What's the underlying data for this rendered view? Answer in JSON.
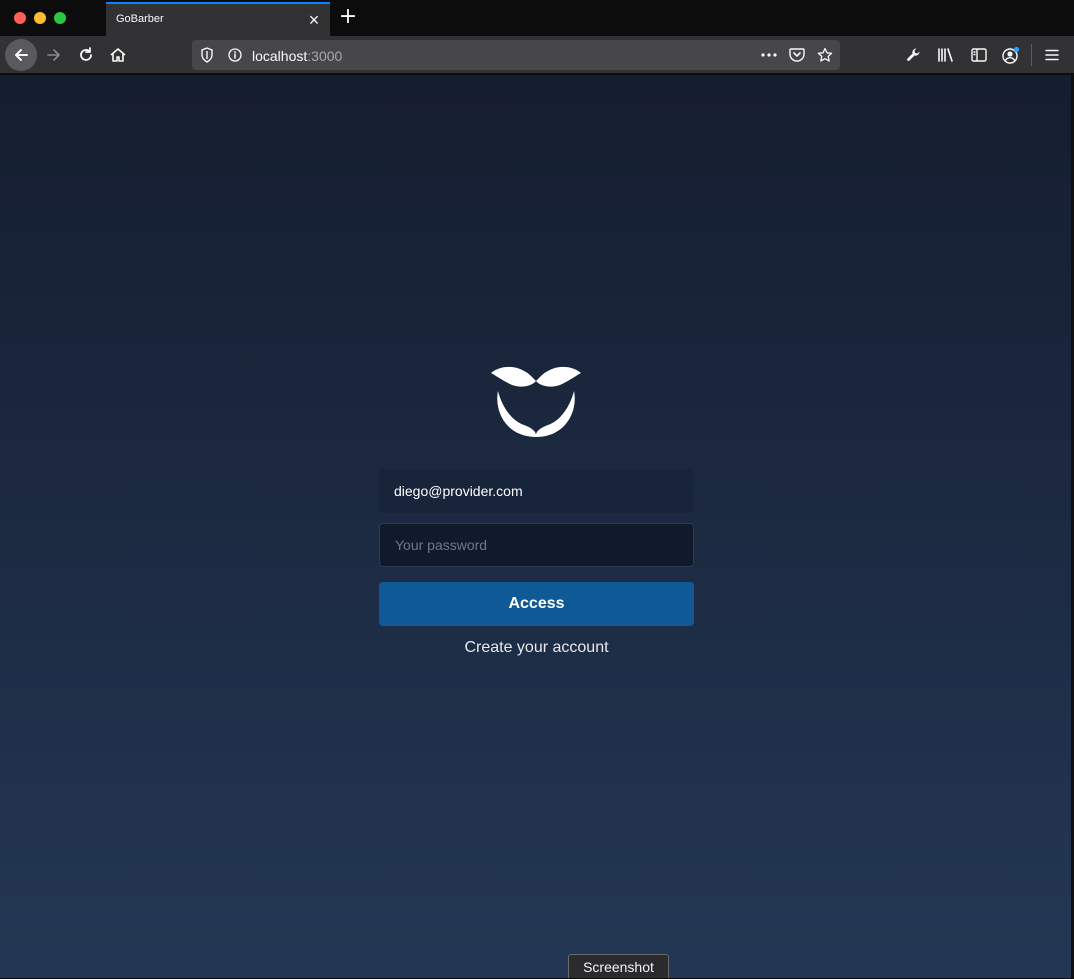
{
  "browser": {
    "tab_title": "GoBarber",
    "url_host": "localhost",
    "url_port": ":3000",
    "icons": [
      "back-arrow-icon",
      "forward-arrow-icon",
      "reload-icon",
      "home-icon",
      "shield-icon",
      "info-icon",
      "more-icon",
      "pocket-icon",
      "bookmark-star-icon",
      "wrench-icon",
      "library-icon",
      "sidebar-icon",
      "account-icon",
      "menu-icon"
    ]
  },
  "login": {
    "email_value": "diego@provider.com",
    "password_placeholder": "Your password",
    "access_label": "Access",
    "create_account_label": "Create your account"
  },
  "overlay": {
    "tooltip": "Screenshot"
  },
  "colors": {
    "accent": "#0f5a96",
    "background_top": "#151d2f",
    "background_bottom": "#233754"
  }
}
